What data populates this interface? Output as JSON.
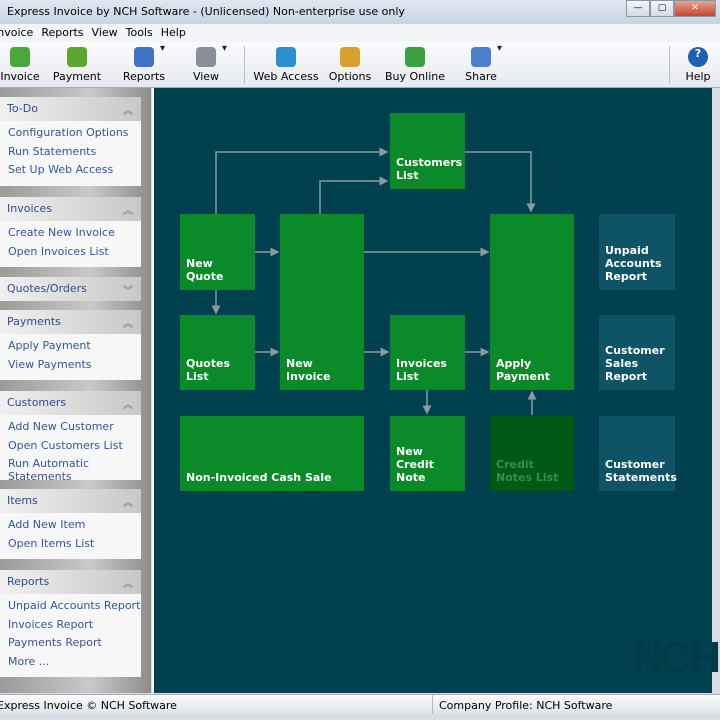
{
  "window": {
    "title": "Express Invoice by NCH Software - (Unlicensed) Non-enterprise use only",
    "buttons": [
      "minimize",
      "maximize",
      "close"
    ]
  },
  "menu": [
    "Invoice",
    "Reports",
    "View",
    "Tools",
    "Help"
  ],
  "toolbar": [
    {
      "label": "Invoice",
      "icon": "new-invoice-icon",
      "color": "#4aa83a"
    },
    {
      "label": "Payment",
      "icon": "payment-icon",
      "color": "#5aa830"
    },
    {
      "label": "Reports",
      "icon": "pie-chart-icon",
      "color": "#3f72c4",
      "dropdown": true
    },
    {
      "label": "View",
      "icon": "view-icon",
      "color": "#8a8f98",
      "dropdown": true
    },
    {
      "label": "Web Access",
      "icon": "web-access-icon",
      "color": "#2b8fd0"
    },
    {
      "label": "Options",
      "icon": "options-icon",
      "color": "#d9a030"
    },
    {
      "label": "Buy Online",
      "icon": "buy-online-icon",
      "color": "#3aa040"
    },
    {
      "label": "Share",
      "icon": "share-icon",
      "color": "#4a7fcc",
      "dropdown": true
    },
    {
      "label": "Help",
      "icon": "help-icon",
      "color": "#1f5fb0"
    }
  ],
  "sidebar": [
    {
      "title": "To-Do",
      "expanded": true,
      "items": [
        "Configuration Options",
        "Run Statements",
        "Set Up Web Access"
      ]
    },
    {
      "title": "Invoices",
      "expanded": true,
      "items": [
        "Create New Invoice",
        "Open Invoices List"
      ]
    },
    {
      "title": "Quotes/Orders",
      "expanded": false,
      "items": []
    },
    {
      "title": "Payments",
      "expanded": true,
      "items": [
        "Apply Payment",
        "View Payments"
      ]
    },
    {
      "title": "Customers",
      "expanded": true,
      "items": [
        "Add New Customer",
        "Open Customers List",
        "Run Automatic Statements"
      ]
    },
    {
      "title": "Items",
      "expanded": true,
      "items": [
        "Add New Item",
        "Open Items List"
      ]
    },
    {
      "title": "Reports",
      "expanded": true,
      "items": [
        "Unpaid Accounts Report",
        "Invoices Report",
        "Payments Report",
        "More ..."
      ]
    }
  ],
  "flow": {
    "customers_list": "Customers List",
    "new_quote": "New Quote",
    "new_invoice": "New Invoice",
    "apply_payment": "Apply Payment",
    "unpaid_accounts_report": "Unpaid Accounts Report",
    "quotes_list": "Quotes List",
    "invoices_list": "Invoices List",
    "customer_sales_report": "Customer Sales Report",
    "cash_sale": "Non-Invoiced Cash Sale",
    "new_credit_note": "New Credit Note",
    "credit_notes_list": "Credit Notes List",
    "customer_statements": "Customer Statements",
    "watermark": "NCH"
  },
  "colors": {
    "canvas": "#00404f",
    "action": "#0a8a28",
    "report": "#0f5366",
    "disabled": "#005a16"
  },
  "status": {
    "left": "Express Invoice © NCH Software",
    "right": "Company Profile: NCH Software"
  }
}
